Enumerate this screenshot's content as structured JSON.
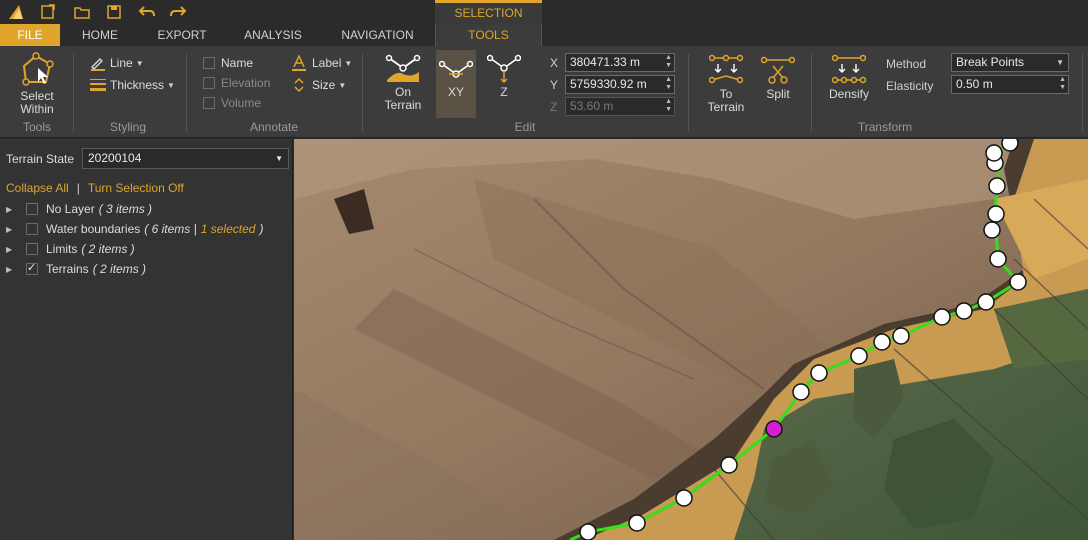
{
  "quick_access": {
    "icons": [
      "app-logo-icon",
      "new-project-icon",
      "open-folder-icon",
      "save-icon",
      "undo-icon",
      "redo-icon"
    ]
  },
  "context_tab": "SELECTION",
  "tabs": [
    {
      "label": "FILE"
    },
    {
      "label": "HOME"
    },
    {
      "label": "EXPORT"
    },
    {
      "label": "ANALYSIS"
    },
    {
      "label": "NAVIGATION"
    },
    {
      "label": "TOOLS"
    }
  ],
  "ribbon": {
    "tools": {
      "select_within": "Select\nWithin",
      "group": "Tools"
    },
    "styling": {
      "line": "Line",
      "thickness": "Thickness",
      "group": "Styling"
    },
    "annotate": {
      "name": "Name",
      "elevation": "Elevation",
      "volume": "Volume",
      "label": "Label",
      "size": "Size",
      "group": "Annotate"
    },
    "edit": {
      "on_terrain": "On\nTerrain",
      "xy": "XY",
      "z": "Z",
      "x_label": "X",
      "y_label": "Y",
      "z_label": "Z",
      "x_value": "380471.33 m",
      "y_value": "5759330.92 m",
      "z_value": "53.60 m",
      "group": "Edit"
    },
    "transform": {
      "to_terrain": "To\nTerrain",
      "split": "Split",
      "densify": "Densify",
      "method_label": "Method",
      "method_value": "Break Points",
      "elasticity_label": "Elasticity",
      "elasticity_value": "0.50 m",
      "group": "Transform"
    }
  },
  "left_panel": {
    "terrain_state_label": "Terrain State",
    "terrain_state_value": "20200104",
    "collapse_all": "Collapse All",
    "separator": "|",
    "turn_selection_off": "Turn Selection Off",
    "layers": [
      {
        "name": "No Layer",
        "count": "( 3 items )",
        "checked": false
      },
      {
        "name": "Water boundaries",
        "count_prefix": "( 6 items |",
        "selected": "1 selected",
        "count_suffix": ")",
        "checked": false
      },
      {
        "name": "Limits",
        "count": "( 2 items )",
        "checked": false
      },
      {
        "name": "Terrains",
        "count": "( 2 items )",
        "checked": true
      }
    ]
  },
  "colors": {
    "accent": "#e0a52a",
    "polyline": "#33e01a",
    "selected_vertex": "#d21fd2"
  }
}
